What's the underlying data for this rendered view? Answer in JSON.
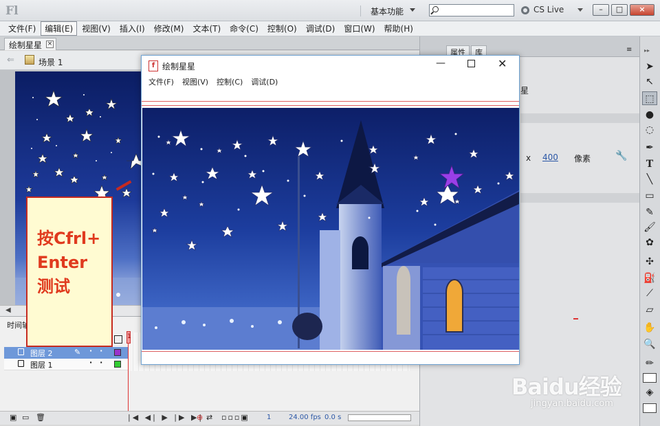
{
  "app": {
    "logo": "Fl",
    "workspace_label": "基本功能",
    "search_placeholder": "",
    "cslive_label": "CS Live",
    "win_min": "–",
    "win_max": "□",
    "win_close": "×"
  },
  "menu": [
    "文件(F)",
    "编辑(E)",
    "视图(V)",
    "插入(I)",
    "修改(M)",
    "文本(T)",
    "命令(C)",
    "控制(O)",
    "调试(D)",
    "窗口(W)",
    "帮助(H)"
  ],
  "document": {
    "tab_title": "绘制星星",
    "scene_label": "场景 1"
  },
  "timeline": {
    "tab_label": "时间轴",
    "layers": [
      {
        "name": "图层 2",
        "color": "#9933cc",
        "selected": true
      },
      {
        "name": "图层 1",
        "color": "#33cc33",
        "selected": false
      }
    ],
    "frame_marker": "1",
    "current_frame": "1",
    "fps": "24.00 fps",
    "time": "0.0 s"
  },
  "properties": {
    "tabs": [
      "属性",
      "库"
    ],
    "title_fragment": "星",
    "x_label": "x",
    "x_value": "400",
    "unit_label": "像素"
  },
  "preview": {
    "title": "绘制星星",
    "menu": [
      "文件(F)",
      "视图(V)",
      "控制(C)",
      "调试(D)"
    ],
    "min_glyph": "—",
    "close_glyph": "✕"
  },
  "annotation": {
    "lines": [
      "按Cfrl+",
      "Enter",
      "测试"
    ]
  },
  "watermark": {
    "brand": "Baidu经验",
    "url": "jingyan.baidu.com"
  },
  "colors": {
    "note_text": "#e03a1e",
    "note_border": "#c62a20",
    "note_bg": "#fffbd2",
    "selected_layer": "#6e98d9",
    "sky": "#16308a",
    "highlight_star": "#9a3fe8"
  }
}
